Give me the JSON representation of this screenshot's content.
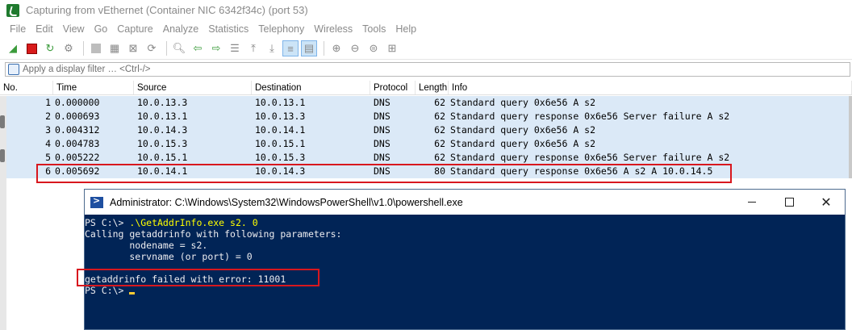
{
  "wireshark": {
    "title": "Capturing from vEthernet (Container NIC 6342f34c) (port 53)",
    "menu": [
      "File",
      "Edit",
      "View",
      "Go",
      "Capture",
      "Analyze",
      "Statistics",
      "Telephony",
      "Wireless",
      "Tools",
      "Help"
    ],
    "filter_placeholder": "Apply a display filter … <Ctrl-/>",
    "columns": [
      "No.",
      "Time",
      "Source",
      "Destination",
      "Protocol",
      "Length",
      "Info"
    ],
    "packets": [
      {
        "no": "1",
        "time": "0.000000",
        "src": "10.0.13.3",
        "dst": "10.0.13.1",
        "proto": "DNS",
        "len": "62",
        "info": "Standard query 0x6e56 A s2"
      },
      {
        "no": "2",
        "time": "0.000693",
        "src": "10.0.13.1",
        "dst": "10.0.13.3",
        "proto": "DNS",
        "len": "62",
        "info": "Standard query response 0x6e56 Server failure A s2"
      },
      {
        "no": "3",
        "time": "0.004312",
        "src": "10.0.14.3",
        "dst": "10.0.14.1",
        "proto": "DNS",
        "len": "62",
        "info": "Standard query 0x6e56 A s2"
      },
      {
        "no": "4",
        "time": "0.004783",
        "src": "10.0.15.3",
        "dst": "10.0.15.1",
        "proto": "DNS",
        "len": "62",
        "info": "Standard query 0x6e56 A s2"
      },
      {
        "no": "5",
        "time": "0.005222",
        "src": "10.0.15.1",
        "dst": "10.0.15.3",
        "proto": "DNS",
        "len": "62",
        "info": "Standard query response 0x6e56 Server failure A s2"
      },
      {
        "no": "6",
        "time": "0.005692",
        "src": "10.0.14.1",
        "dst": "10.0.14.3",
        "proto": "DNS",
        "len": "80",
        "info": "Standard query response 0x6e56 A s2 A 10.0.14.5"
      }
    ],
    "row_color": "#dbe9f7"
  },
  "powershell": {
    "title": "Administrator: C:\\Windows\\System32\\WindowsPowerShell\\v1.0\\powershell.exe",
    "prompt1": "PS C:\\> ",
    "command": ".\\GetAddrInfo.exe s2. 0",
    "output": [
      "Calling getaddrinfo with following parameters:",
      "        nodename = s2.",
      "        servname (or port) = 0",
      "",
      "getaddrinfo failed with error: 11001"
    ],
    "prompt2": "PS C:\\> ",
    "background": "#012456",
    "command_color": "#ffff00"
  },
  "annotation_color": "#d8171e"
}
